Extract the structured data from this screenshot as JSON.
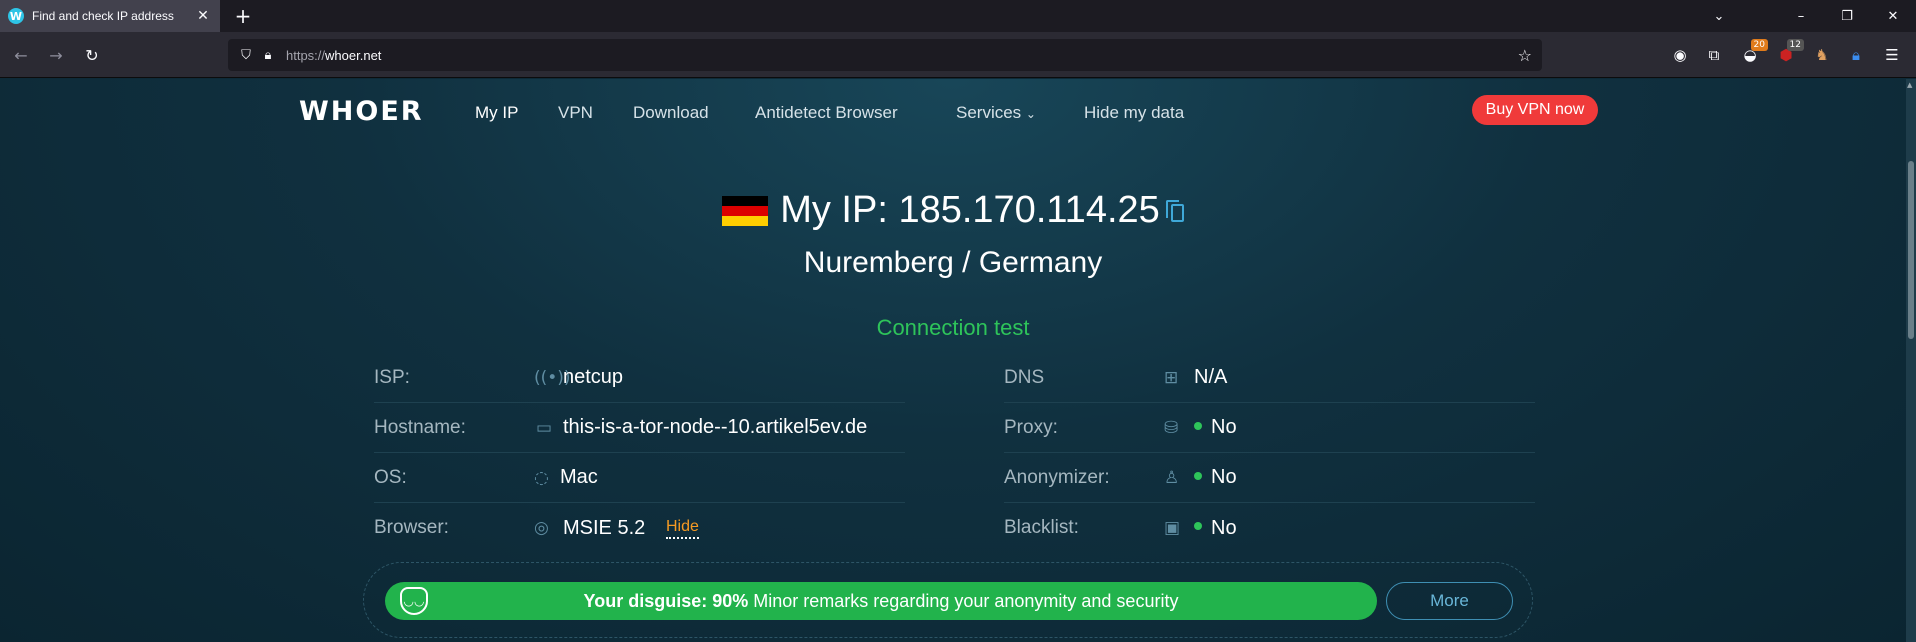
{
  "browser": {
    "tab_title": "Find and check IP address",
    "favicon_letter": "W",
    "url_protocol": "https://",
    "url_host": "whoer.net",
    "extension_badges": {
      "ext1": "20",
      "ext2": "12"
    }
  },
  "site": {
    "logo": "WHOER",
    "nav": [
      "My IP",
      "VPN",
      "Download",
      "Antidetect Browser",
      "Services",
      "Hide my data"
    ],
    "services_caret": "⌄",
    "buy_button": "Buy VPN now"
  },
  "hero": {
    "ip_label": "My IP:",
    "ip": "185.170.114.25",
    "location": "Nuremberg / Germany",
    "flag_colors": [
      "#000000",
      "#dd0000",
      "#ffce00"
    ]
  },
  "connection_test": {
    "title": "Connection test",
    "left": [
      {
        "label": "ISP:",
        "value": "netcup",
        "icon": "signal-icon"
      },
      {
        "label": "Hostname:",
        "value": "this-is-a-tor-node--10.artikel5ev.de",
        "icon": "monitor-icon"
      },
      {
        "label": "OS:",
        "value": "Mac",
        "icon": "apple-icon"
      },
      {
        "label": "Browser:",
        "value": "MSIE 5.2",
        "icon": "browser-icon",
        "action": "Hide"
      }
    ],
    "right": [
      {
        "label": "DNS",
        "value": "N/A",
        "icon": "network-icon"
      },
      {
        "label": "Proxy:",
        "value": "No",
        "icon": "database-icon"
      },
      {
        "label": "Anonymizer:",
        "value": "No",
        "icon": "anonymizer-icon"
      },
      {
        "label": "Blacklist:",
        "value": "No",
        "icon": "blacklist-icon"
      }
    ]
  },
  "disguise": {
    "prefix": "Your disguise:",
    "percent": "90%",
    "message": "Minor remarks regarding your anonymity and security",
    "more": "More"
  },
  "colors": {
    "accent_green": "#22b34c",
    "buy_red": "#f03a3a",
    "hide_orange": "#f59a23"
  }
}
